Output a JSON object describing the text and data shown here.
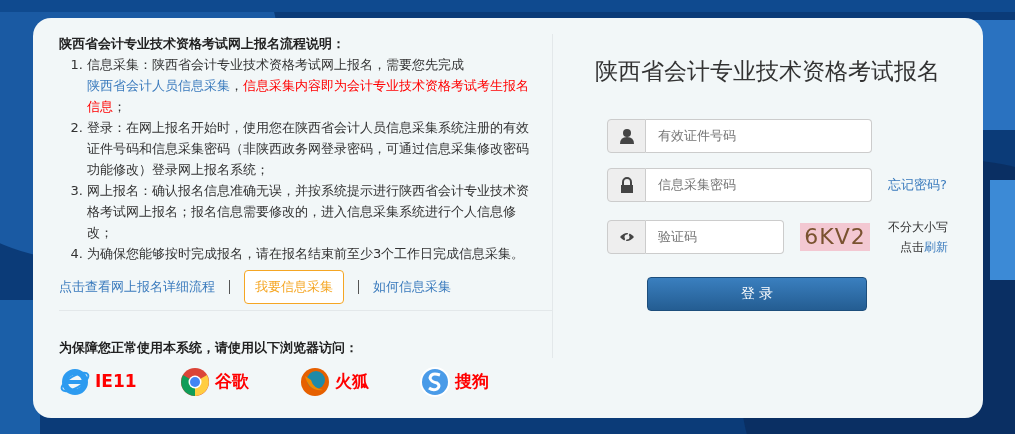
{
  "instructions": {
    "title": "陕西省会计专业技术资格考试网上报名流程说明：",
    "steps": [
      {
        "number": "1.",
        "segments": [
          {
            "kind": "text",
            "text": "信息采集：陕西省会计专业技术资格考试网上报名，需要您先完成"
          },
          {
            "kind": "link",
            "text": "陕西省会计人员信息采集"
          },
          {
            "kind": "text",
            "text": "，"
          },
          {
            "kind": "alert",
            "text": "信息采集内容即为会计专业技术资格考试考生报名信息"
          },
          {
            "kind": "text",
            "text": "；"
          }
        ]
      },
      {
        "number": "2.",
        "segments": [
          {
            "kind": "text",
            "text": "登录：在网上报名开始时，使用您在陕西省会计人员信息采集系统注册的有效证件号码和信息采集密码（非陕西政务网登录密码，可通过信息采集修改密码功能修改）登录网上报名系统；"
          }
        ]
      },
      {
        "number": "3.",
        "segments": [
          {
            "kind": "text",
            "text": "网上报名：确认报名信息准确无误，并按系统提示进行陕西省会计专业技术资格考试网上报名；报名信息需要修改的，进入信息采集系统进行个人信息修改；"
          }
        ]
      },
      {
        "number": "4.",
        "segments": [
          {
            "kind": "text",
            "text": "为确保您能够按时完成报名，请在报名结束前至少3个工作日完成信息采集。"
          }
        ]
      }
    ],
    "links": [
      {
        "kind": "link",
        "text": "点击查看网上报名详细流程"
      },
      {
        "kind": "button",
        "text": "我要信息采集"
      },
      {
        "kind": "link",
        "text": "如何信息采集"
      }
    ]
  },
  "browsers": {
    "title": "为保障您正常使用本系统，请使用以下浏览器访问：",
    "items": [
      {
        "kind": "ie",
        "label": "IE11"
      },
      {
        "kind": "chrome",
        "label": "谷歌"
      },
      {
        "kind": "firefox",
        "label": "火狐"
      },
      {
        "kind": "sogou",
        "label": "搜狗"
      }
    ]
  },
  "login": {
    "title": "陕西省会计专业技术资格考试报名",
    "fields": [
      {
        "kind": "user",
        "placeholder": "有效证件号码"
      },
      {
        "kind": "lock",
        "placeholder": "信息采集密码",
        "link": "忘记密码?"
      },
      {
        "kind": "captcha",
        "placeholder": "验证码",
        "captcha": "6KV2",
        "hint": "不分大小写",
        "refresh_prefix": "点击",
        "refresh_link": "刷新"
      }
    ],
    "submit": "登 录"
  }
}
